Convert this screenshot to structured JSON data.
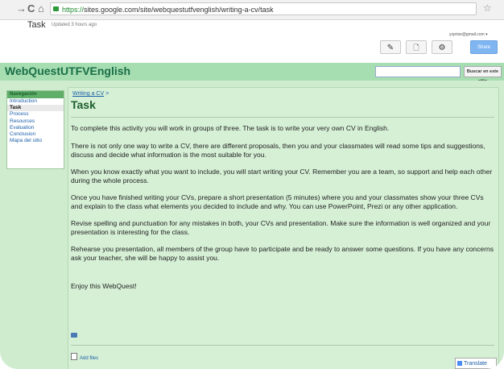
{
  "browser": {
    "url_https": "https://",
    "url_rest": "sites.google.com/site/webquestutfvenglish/writing-a-cv/task"
  },
  "sites_header": {
    "page_title": "Task",
    "updated": "Updated 3 hours ago",
    "user_email": "yzprise@gmail.com ▾",
    "share_label": "Share"
  },
  "site": {
    "name": "WebQuestUTFVEnglish",
    "search_button": "Buscar en este sitio"
  },
  "sidebar": {
    "heading": "Navegación",
    "items": [
      {
        "label": "Introduction"
      },
      {
        "label": "Task"
      },
      {
        "label": "Process"
      },
      {
        "label": "Resources"
      },
      {
        "label": "Evaluation"
      },
      {
        "label": "Conclusion"
      },
      {
        "label": "Mapa del sitio"
      }
    ]
  },
  "content": {
    "breadcrumb_link": "Writing a CV",
    "breadcrumb_sep": ">",
    "title": "Task",
    "paragraphs": [
      "To complete this activity you will work in groups of three. The task is to write your very own CV in English.",
      "There is not only one way to write a CV, there are different proposals, then you and your classmates will read some tips and suggestions, discuss and decide what information is the most suitable for you.",
      "When you know exactly what you want to include, you will start writing your CV. Remember you are a team, so support and help each other during the whole process.",
      "Once you have finished writing your CVs, prepare a short presentation (5 minutes) where you and your classmates show your three CVs and explain to the class what elements you decided to include and why. You can use PowerPoint, Prezi or any other application.",
      "Revise spelling and punctuation for any mistakes in both, your CVs and presentation. Make sure the information is well organized and your presentation is interesting for the class.",
      "Rehearse you presentation, all members of the group have to participate and be ready to answer some questions. If you have any concerns ask your teacher, she will be happy to assist you.",
      "Enjoy this WebQuest!"
    ],
    "add_files": "Add files",
    "translate": "Translate"
  },
  "colors": {
    "header_green": "#a6ddb1",
    "site_name": "#1a6f47",
    "content_bg": "#d6f0d6",
    "link_blue": "#1a5fa8"
  }
}
